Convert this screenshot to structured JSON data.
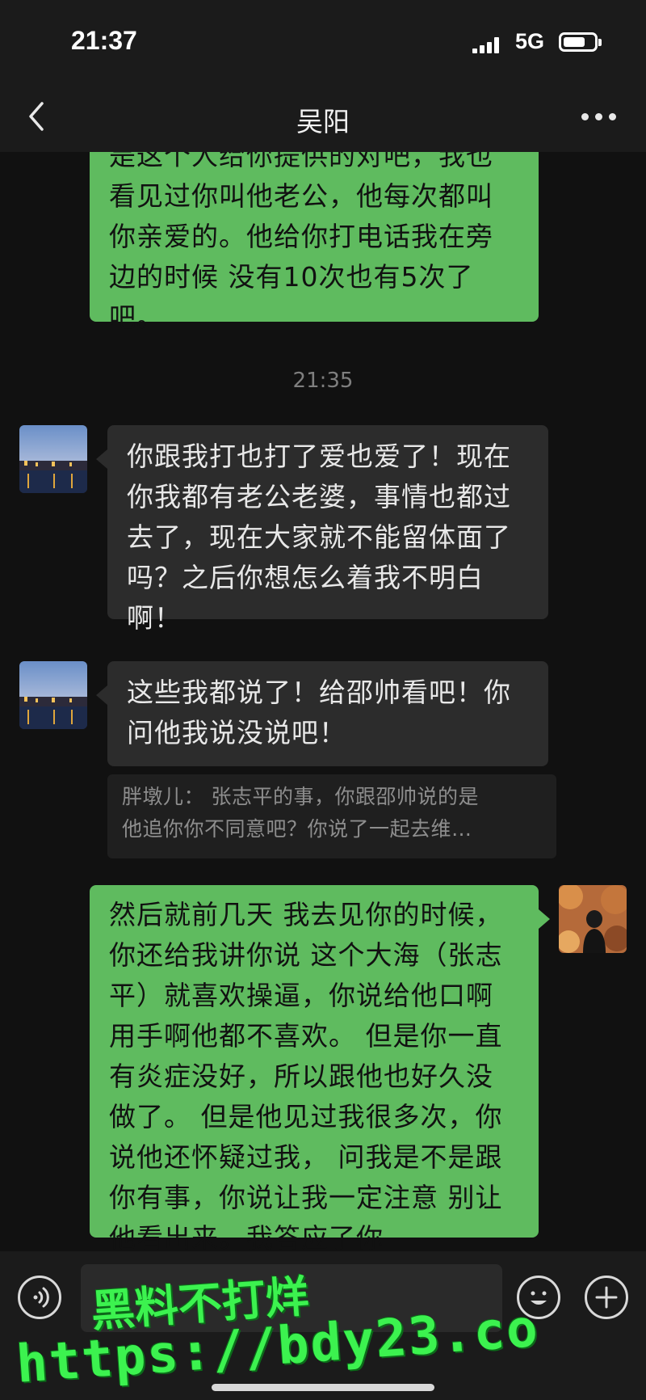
{
  "status_bar": {
    "time": "21:37",
    "network": "5G",
    "icons": [
      "signal-icon",
      "battery-icon"
    ]
  },
  "header": {
    "title": "吴阳",
    "back_icon": "chevron-left-icon",
    "more_icon": "more-dots-icon"
  },
  "messages": [
    {
      "direction": "outgoing",
      "lines": [
        "是这个人给你提供的对吧，我也",
        "看见过你叫他老公，他每次都叫",
        "你亲爱的。他给你打电话我在旁",
        "边的时候 没有10次也有5次了",
        "吧。"
      ]
    },
    {
      "type": "timestamp",
      "text": "21:35"
    },
    {
      "direction": "incoming",
      "lines": [
        "你跟我打也打了爱也爱了！现在",
        "你我都有老公老婆，事情也都过",
        "去了，现在大家就不能留体面了",
        "吗？之后你想怎么着我不明白",
        "啊！"
      ]
    },
    {
      "direction": "incoming",
      "lines": [
        "这些我都说了！给邵帅看吧！你",
        "问他我说没说吧！"
      ],
      "quote": {
        "lines": [
          "胖墩儿： 张志平的事，你跟邵帅说的是",
          "他追你你不同意吧？你说了一起去维…"
        ]
      }
    },
    {
      "direction": "outgoing",
      "lines": [
        "然后就前几天 我去见你的时候，",
        "你还给我讲你说 这个大海（张志",
        "平）就喜欢操逼，你说给他口啊",
        "用手啊他都不喜欢。 但是你一直",
        "有炎症没好，所以跟他也好久没",
        "做了。 但是他见过我很多次，你",
        "说他还怀疑过我， 问我是不是跟",
        "你有事，你说让我一定注意 别让",
        "他看出来。我答应了你"
      ]
    }
  ],
  "input_bar": {
    "voice_icon": "voice-icon",
    "emoji_icon": "emoji-icon",
    "plus_icon": "plus-icon"
  },
  "watermark": {
    "line1": "黑料不打烊",
    "line2": "https://bdy23.co"
  },
  "colors": {
    "background": "#111111",
    "bar": "#1b1b1b",
    "outgoing_bubble": "#5fbb5f",
    "incoming_bubble": "#2c2c2c",
    "watermark": "#3cf24f"
  }
}
